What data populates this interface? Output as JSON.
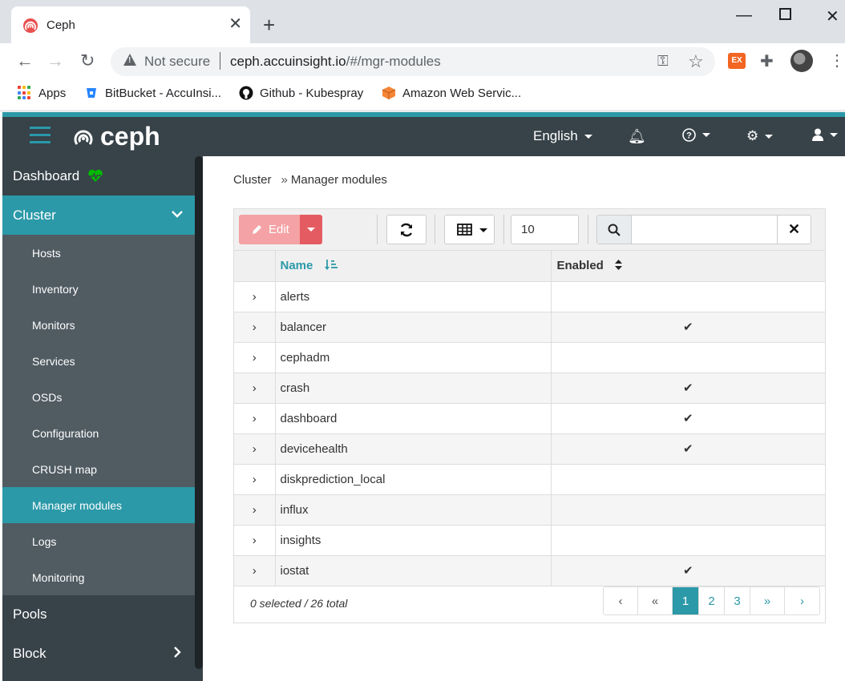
{
  "browser": {
    "tab_title": "Ceph",
    "omnibox_security": "Not secure",
    "url_host": "ceph.accuinsight.io",
    "url_path": "/#/mgr-modules",
    "ext_label": "EX",
    "bookmarks": [
      {
        "label": "Apps"
      },
      {
        "label": "BitBucket - AccuInsi..."
      },
      {
        "label": "Github - Kubespray"
      },
      {
        "label": "Amazon Web Servic..."
      }
    ]
  },
  "app": {
    "logo_text": "ceph",
    "language": "English",
    "accent": "#2b99a8"
  },
  "sidebar": {
    "dashboard": "Dashboard",
    "cluster": "Cluster",
    "items": [
      {
        "label": "Hosts"
      },
      {
        "label": "Inventory"
      },
      {
        "label": "Monitors"
      },
      {
        "label": "Services"
      },
      {
        "label": "OSDs"
      },
      {
        "label": "Configuration"
      },
      {
        "label": "CRUSH map"
      },
      {
        "label": "Manager modules"
      },
      {
        "label": "Logs"
      },
      {
        "label": "Monitoring"
      }
    ],
    "pools": "Pools",
    "block": "Block"
  },
  "breadcrumb": {
    "parent": "Cluster",
    "current": "Manager modules"
  },
  "toolbar": {
    "edit_label": "Edit",
    "page_size": "10",
    "search_value": ""
  },
  "table": {
    "columns": [
      "Name",
      "Enabled"
    ],
    "rows": [
      {
        "name": "alerts",
        "enabled": ""
      },
      {
        "name": "balancer",
        "enabled": "✔"
      },
      {
        "name": "cephadm",
        "enabled": ""
      },
      {
        "name": "crash",
        "enabled": "✔"
      },
      {
        "name": "dashboard",
        "enabled": "✔"
      },
      {
        "name": "devicehealth",
        "enabled": "✔"
      },
      {
        "name": "diskprediction_local",
        "enabled": ""
      },
      {
        "name": "influx",
        "enabled": ""
      },
      {
        "name": "insights",
        "enabled": ""
      },
      {
        "name": "iostat",
        "enabled": "✔"
      }
    ],
    "summary": "0 selected / 26 total"
  },
  "pagination": {
    "first": "‹",
    "prev": "«",
    "pages": [
      "1",
      "2",
      "3"
    ],
    "next": "»",
    "last": "›"
  }
}
